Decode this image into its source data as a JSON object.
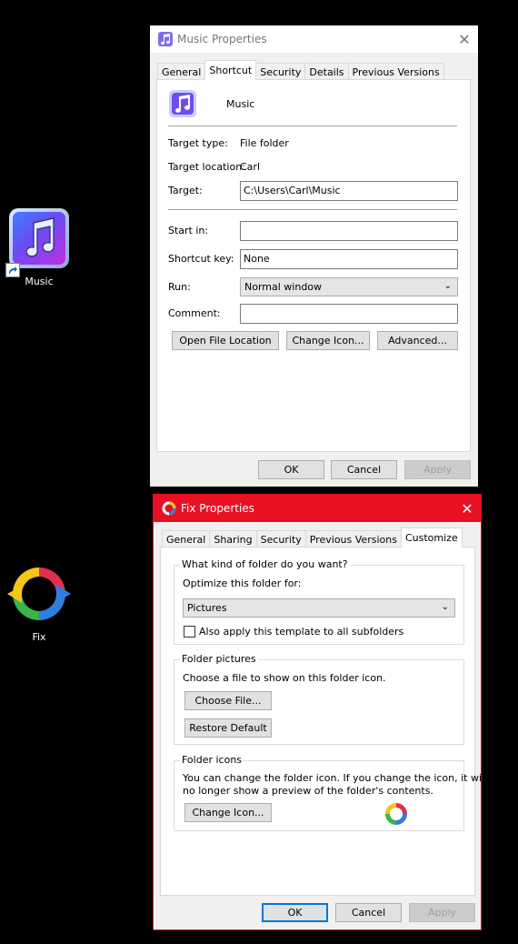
{
  "desktop": {
    "music_label": "Music",
    "fix_label": "Fix"
  },
  "music_window": {
    "title": "Music Properties",
    "tabs": [
      "General",
      "Shortcut",
      "Security",
      "Details",
      "Previous Versions"
    ],
    "active_tab": "Shortcut",
    "name": "Music",
    "target_type_label": "Target type:",
    "target_type_value": "File folder",
    "target_location_label": "Target location:",
    "target_location_value": "Carl",
    "target_label": "Target:",
    "target_value": "C:\\Users\\Carl\\Music",
    "start_in_label": "Start in:",
    "start_in_value": "",
    "shortcut_key_label": "Shortcut key:",
    "shortcut_key_value": "None",
    "run_label": "Run:",
    "run_value": "Normal window",
    "comment_label": "Comment:",
    "comment_value": "",
    "open_file_location": "Open File Location",
    "change_icon": "Change Icon...",
    "advanced": "Advanced...",
    "ok": "OK",
    "cancel": "Cancel",
    "apply": "Apply"
  },
  "fix_window": {
    "title": "Fix Properties",
    "tabs": [
      "General",
      "Sharing",
      "Security",
      "Previous Versions",
      "Customize"
    ],
    "active_tab": "Customize",
    "group1_title": "What kind of folder do you want?",
    "optimize_label": "Optimize this folder for:",
    "optimize_value": "Pictures",
    "apply_subfolders": "Also apply this template to all subfolders",
    "group2_title": "Folder pictures",
    "choose_label": "Choose a file to show on this folder icon.",
    "choose_file": "Choose File...",
    "restore_default": "Restore Default",
    "group3_title": "Folder icons",
    "icons_text_1": "You can change the folder icon. If you change the icon, it will",
    "icons_text_2": "no longer show a preview of the folder's contents.",
    "change_icon": "Change Icon...",
    "ok": "OK",
    "cancel": "Cancel",
    "apply": "Apply"
  },
  "colors": {
    "accent": "#0078d7",
    "fix_titlebar": "#e81123"
  }
}
